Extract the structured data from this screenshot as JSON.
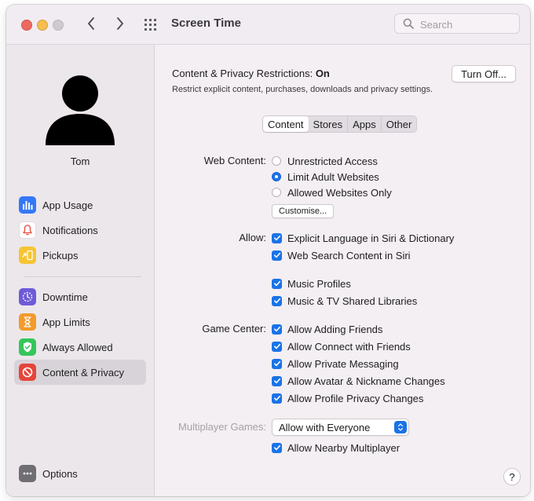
{
  "window": {
    "title": "Screen Time",
    "search_placeholder": "Search"
  },
  "sidebar": {
    "user_name": "Tom",
    "items": [
      {
        "label": "App Usage",
        "icon": "bar-chart-icon",
        "color": "#3478f6"
      },
      {
        "label": "Notifications",
        "icon": "bell-icon",
        "color": "#ffffff"
      },
      {
        "label": "Pickups",
        "icon": "pickup-icon",
        "color": "#f7c433"
      },
      {
        "label": "Downtime",
        "icon": "downtime-icon",
        "color": "#6e5bd8"
      },
      {
        "label": "App Limits",
        "icon": "hourglass-icon",
        "color": "#f39a2c"
      },
      {
        "label": "Always Allowed",
        "icon": "checkmark-shield-icon",
        "color": "#34c759"
      },
      {
        "label": "Content & Privacy",
        "icon": "no-entry-icon",
        "color": "#e5453a",
        "selected": true
      },
      {
        "label": "Options",
        "icon": "ellipsis-icon",
        "color": "#6e6e73"
      }
    ]
  },
  "header": {
    "title_prefix": "Content & Privacy Restrictions:",
    "title_state": "On",
    "subtitle": "Restrict explicit content, purchases, downloads and privacy settings.",
    "turn_off_label": "Turn Off..."
  },
  "tabs": [
    {
      "label": "Content",
      "active": true
    },
    {
      "label": "Stores"
    },
    {
      "label": "Apps"
    },
    {
      "label": "Other"
    }
  ],
  "web_content": {
    "label": "Web Content:",
    "options": [
      {
        "label": "Unrestricted Access",
        "selected": false
      },
      {
        "label": "Limit Adult Websites",
        "selected": true
      },
      {
        "label": "Allowed Websites Only",
        "selected": false
      }
    ],
    "customise_label": "Customise..."
  },
  "allow": {
    "label": "Allow:",
    "items": [
      {
        "label": "Explicit Language in Siri & Dictionary",
        "checked": true
      },
      {
        "label": "Web Search Content in Siri",
        "checked": true
      },
      {
        "label": "Music Profiles",
        "checked": true
      },
      {
        "label": "Music & TV Shared Libraries",
        "checked": true
      }
    ]
  },
  "game_center": {
    "label": "Game Center:",
    "items": [
      {
        "label": "Allow Adding Friends",
        "checked": true
      },
      {
        "label": "Allow Connect with Friends",
        "checked": true
      },
      {
        "label": "Allow Private Messaging",
        "checked": true
      },
      {
        "label": "Allow Avatar & Nickname Changes",
        "checked": true
      },
      {
        "label": "Allow Profile Privacy Changes",
        "checked": true
      }
    ]
  },
  "multiplayer": {
    "label": "Multiplayer Games:",
    "selected_value": "Allow with Everyone",
    "nearby_label": "Allow Nearby Multiplayer",
    "nearby_checked": true
  },
  "help_label": "?"
}
